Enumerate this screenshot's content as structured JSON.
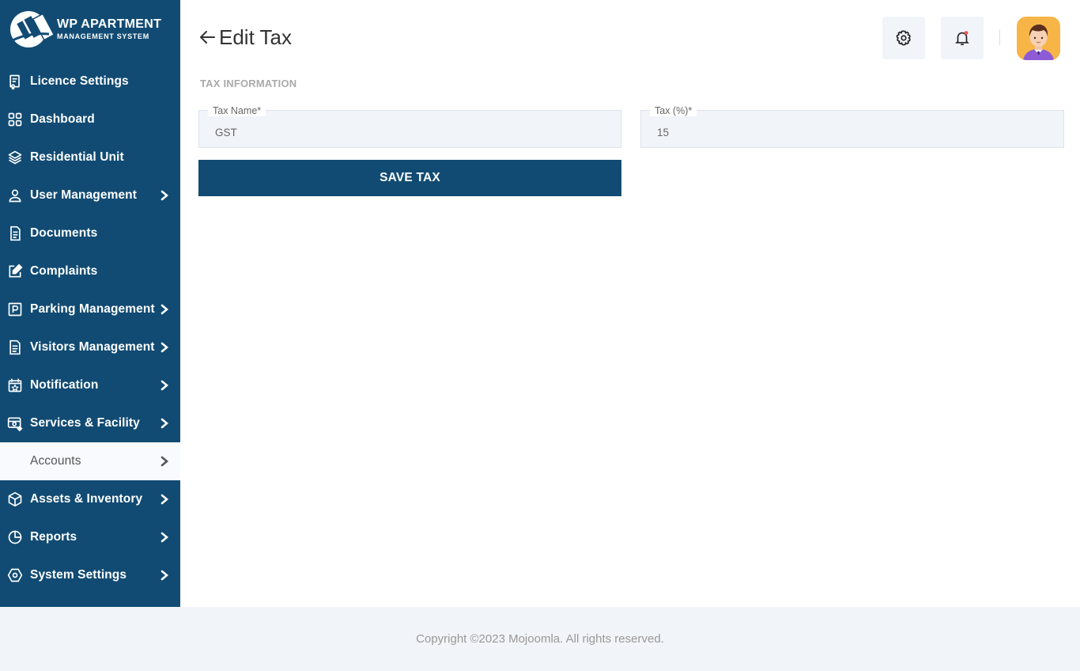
{
  "brand": {
    "title": "WP APARTMENT",
    "subtitle": "MANAGEMENT SYSTEM"
  },
  "sidebar": {
    "items": [
      {
        "label": "Licence Settings",
        "icon": "licence-icon",
        "has_submenu": false,
        "active": false
      },
      {
        "label": "Dashboard",
        "icon": "dashboard-grid-icon",
        "has_submenu": false,
        "active": false
      },
      {
        "label": "Residential Unit",
        "icon": "layers-icon",
        "has_submenu": false,
        "active": false
      },
      {
        "label": "User Management",
        "icon": "user-icon",
        "has_submenu": true,
        "active": false
      },
      {
        "label": "Documents",
        "icon": "document-icon",
        "has_submenu": false,
        "active": false
      },
      {
        "label": "Complaints",
        "icon": "edit-icon",
        "has_submenu": false,
        "active": false
      },
      {
        "label": "Parking Management",
        "icon": "parking-icon",
        "has_submenu": true,
        "active": false
      },
      {
        "label": "Visitors Management",
        "icon": "file-text-icon",
        "has_submenu": true,
        "active": false
      },
      {
        "label": "Notification",
        "icon": "calendar-star-icon",
        "has_submenu": true,
        "active": false
      },
      {
        "label": "Services & Facility",
        "icon": "services-icon",
        "has_submenu": true,
        "active": false
      },
      {
        "label": "Accounts",
        "icon": "accounts-icon",
        "has_submenu": true,
        "active": true
      },
      {
        "label": "Assets & Inventory",
        "icon": "box-icon",
        "has_submenu": true,
        "active": false
      },
      {
        "label": "Reports",
        "icon": "pie-chart-icon",
        "has_submenu": true,
        "active": false
      },
      {
        "label": "System Settings",
        "icon": "hex-settings-icon",
        "has_submenu": true,
        "active": false
      }
    ]
  },
  "header": {
    "title": "Edit Tax",
    "back_icon": "arrow-left-icon",
    "settings_icon": "gear-icon",
    "notification_icon": "bell-icon",
    "notification_dot_color": "#f0554d"
  },
  "form": {
    "section_title": "TAX INFORMATION",
    "tax_name": {
      "label": "Tax Name*",
      "value": "GST"
    },
    "tax_percent": {
      "label": "Tax (%)*",
      "value": "15"
    },
    "save_label": "SAVE TAX"
  },
  "footer": {
    "copyright": "Copyright ©2023 Mojoomla. All rights reserved."
  },
  "colors": {
    "primary": "#114b73",
    "field_bg": "#f1f4f9",
    "avatar_bg": "#f7b548"
  }
}
